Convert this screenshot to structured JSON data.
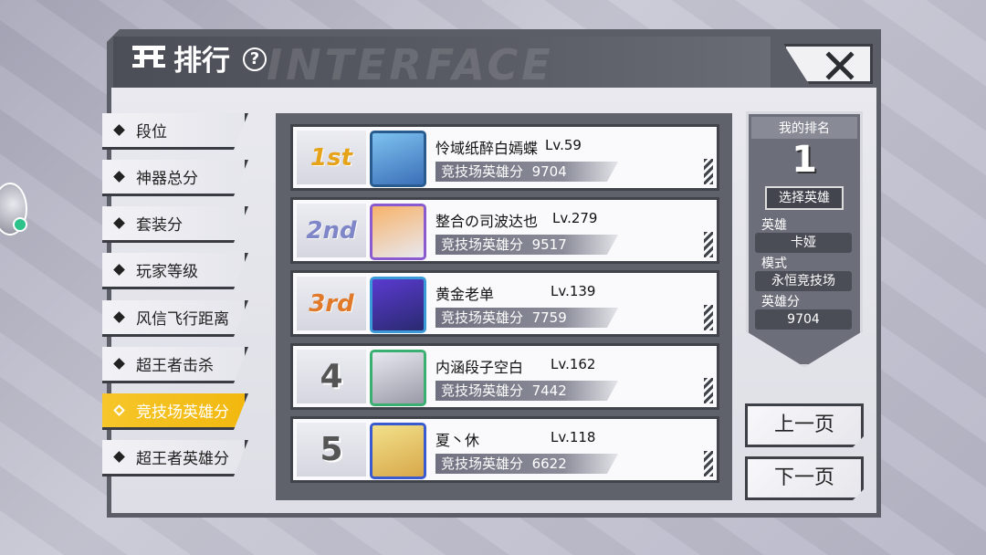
{
  "header": {
    "title": "排行",
    "watermark": "INTERFACE"
  },
  "tabs": [
    {
      "label": "段位",
      "active": false
    },
    {
      "label": "神器总分",
      "active": false
    },
    {
      "label": "套装分",
      "active": false
    },
    {
      "label": "玩家等级",
      "active": false
    },
    {
      "label": "风信飞行距离",
      "active": false
    },
    {
      "label": "超王者击杀",
      "active": false
    },
    {
      "label": "竞技场英雄分",
      "active": true
    },
    {
      "label": "超王者英雄分",
      "active": false
    }
  ],
  "rankings": [
    {
      "rank": "1st",
      "name": "怜域纸醉白嫣蝶",
      "level": "Lv.59",
      "score_label": "竞技场英雄分",
      "score": "9704",
      "avatar_color": "#5aa0d8"
    },
    {
      "rank": "2nd",
      "name": "整合の司波达也",
      "level": "Lv.279",
      "score_label": "竞技场英雄分",
      "score": "9517",
      "avatar_color": "#f08a3a"
    },
    {
      "rank": "3rd",
      "name": "黄金老单",
      "level": "Lv.139",
      "score_label": "竞技场英雄分",
      "score": "7759",
      "avatar_color": "#3a5ad8"
    },
    {
      "rank": "4",
      "name": "内涵段子空白",
      "level": "Lv.162",
      "score_label": "竞技场英雄分",
      "score": "7442",
      "avatar_color": "#b0b0c0"
    },
    {
      "rank": "5",
      "name": "夏丶休",
      "level": "Lv.118",
      "score_label": "竞技场英雄分",
      "score": "6622",
      "avatar_color": "#e8d070"
    }
  ],
  "my_rank": {
    "title": "我的排名",
    "rank": "1",
    "select_button": "选择英雄",
    "hero_label": "英雄",
    "hero_value": "卡娅",
    "mode_label": "模式",
    "mode_value": "永恒竞技场",
    "score_label": "英雄分",
    "score_value": "9704"
  },
  "pagination": {
    "prev": "上一页",
    "next": "下一页"
  },
  "colors": {
    "gold": "#e6a31a",
    "silver": "#7f86c8",
    "bronze": "#e07a2a",
    "active_tab": "#f2b80f"
  }
}
